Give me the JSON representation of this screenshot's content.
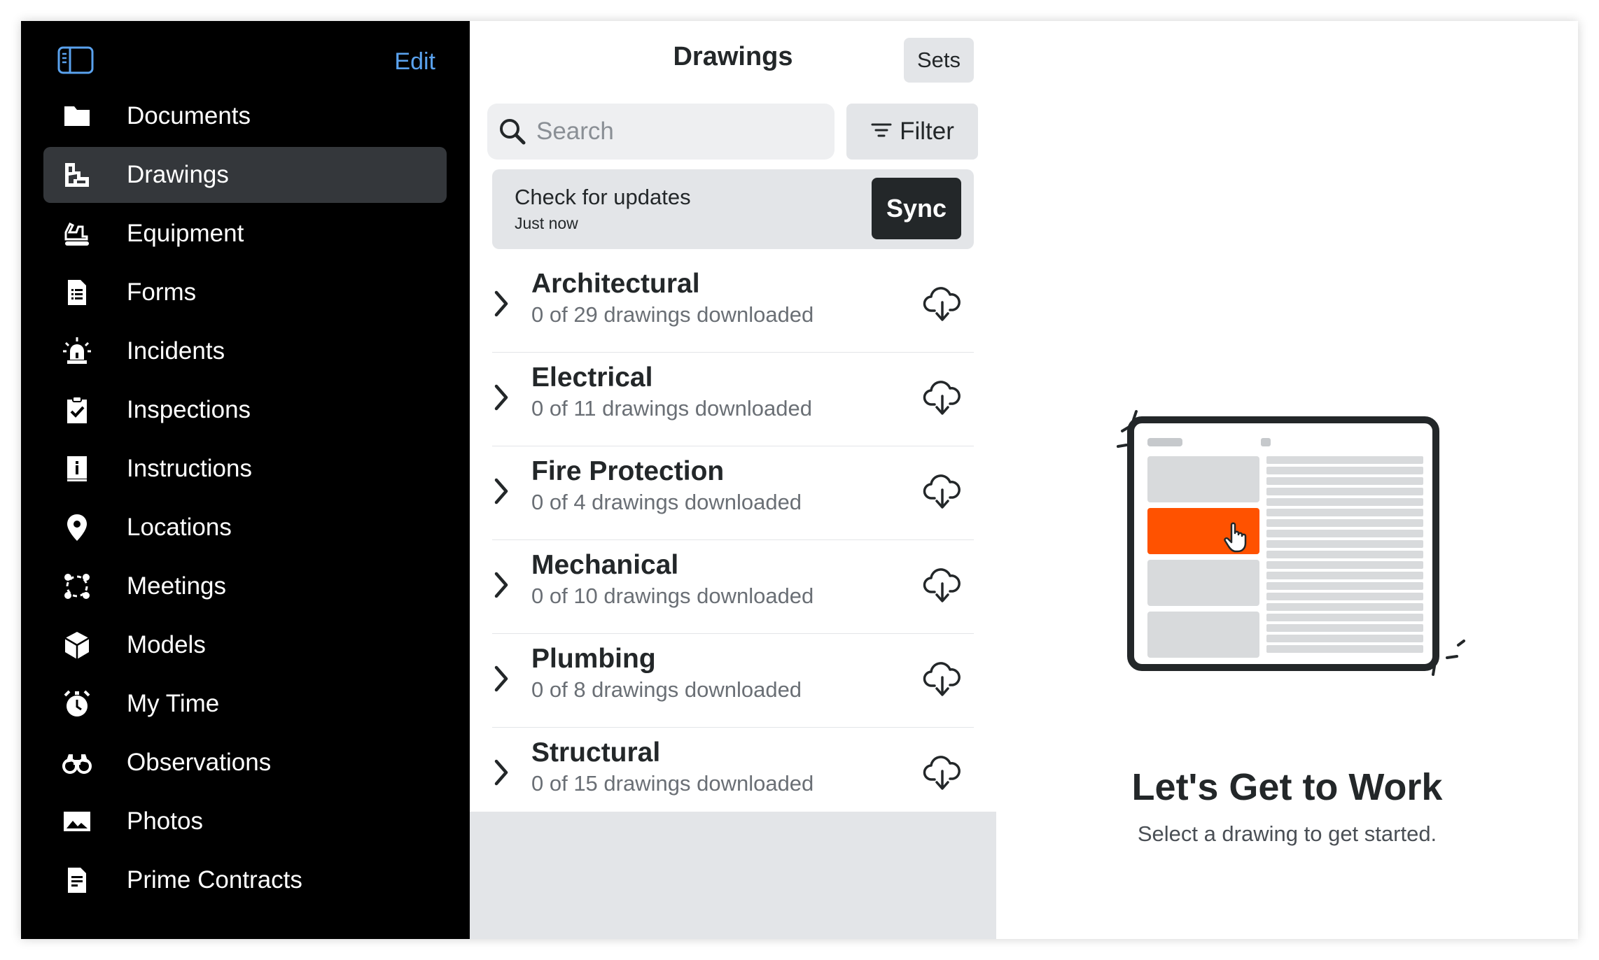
{
  "sidebar": {
    "edit_label": "Edit",
    "items": [
      {
        "label": "Documents",
        "icon": "folder-icon",
        "active": false
      },
      {
        "label": "Drawings",
        "icon": "drawings-icon",
        "active": true
      },
      {
        "label": "Equipment",
        "icon": "equipment-icon",
        "active": false
      },
      {
        "label": "Forms",
        "icon": "forms-icon",
        "active": false
      },
      {
        "label": "Incidents",
        "icon": "incidents-icon",
        "active": false
      },
      {
        "label": "Inspections",
        "icon": "inspections-icon",
        "active": false
      },
      {
        "label": "Instructions",
        "icon": "instructions-icon",
        "active": false
      },
      {
        "label": "Locations",
        "icon": "location-pin-icon",
        "active": false
      },
      {
        "label": "Meetings",
        "icon": "meetings-icon",
        "active": false
      },
      {
        "label": "Models",
        "icon": "cube-icon",
        "active": false
      },
      {
        "label": "My Time",
        "icon": "stopwatch-icon",
        "active": false
      },
      {
        "label": "Observations",
        "icon": "binoculars-icon",
        "active": false
      },
      {
        "label": "Photos",
        "icon": "photo-icon",
        "active": false
      },
      {
        "label": "Prime Contracts",
        "icon": "contract-icon",
        "active": false
      }
    ]
  },
  "middle": {
    "title": "Drawings",
    "sets_label": "Sets",
    "search_placeholder": "Search",
    "filter_label": "Filter",
    "sync_card": {
      "title": "Check for updates",
      "subtitle": "Just now",
      "button_label": "Sync"
    },
    "disciplines": [
      {
        "name": "Architectural",
        "status": "0 of 29 drawings downloaded"
      },
      {
        "name": "Electrical",
        "status": "0 of 11 drawings downloaded"
      },
      {
        "name": "Fire Protection",
        "status": "0 of 4 drawings downloaded"
      },
      {
        "name": "Mechanical",
        "status": "0 of 10 drawings downloaded"
      },
      {
        "name": "Plumbing",
        "status": "0 of 8 drawings downloaded"
      },
      {
        "name": "Structural",
        "status": "0 of 15 drawings downloaded"
      }
    ]
  },
  "empty_state": {
    "title": "Let's Get to Work",
    "subtitle": "Select a drawing to get started.",
    "accent_color": "#ff5200"
  },
  "colors": {
    "sidebar_bg": "#000000",
    "sidebar_active": "#34373b",
    "link_blue": "#5aa2ee",
    "text_dark": "#232729"
  }
}
